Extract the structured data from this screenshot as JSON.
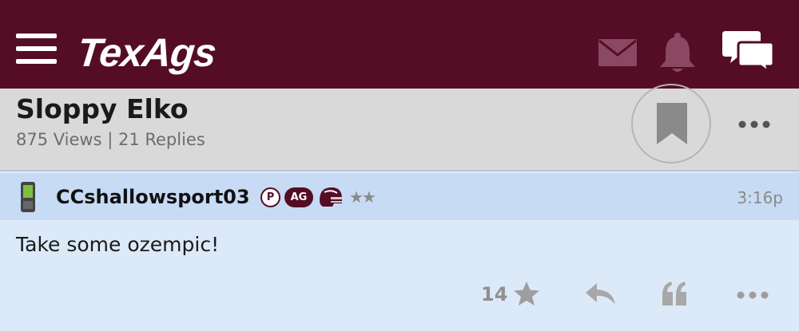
{
  "header": {
    "logo_text": "TexAgs",
    "icons": [
      "menu-icon",
      "mail-icon",
      "bell-icon",
      "chat-icon"
    ]
  },
  "thread": {
    "title": "Sloppy Elko",
    "meta": "875 Views | 21 Replies"
  },
  "post": {
    "username": "CCshallowsport03",
    "badge_p": "P",
    "badge_ag": "AG",
    "stars": "★★",
    "time": "3:16p",
    "body": "Take some ozempic!",
    "like_count": "14"
  },
  "colors": {
    "header_bg": "#550d26",
    "thread_bg": "#d9d9d9",
    "post_head_bg": "#c7dbf4",
    "post_body_bg": "#dce9f8"
  }
}
